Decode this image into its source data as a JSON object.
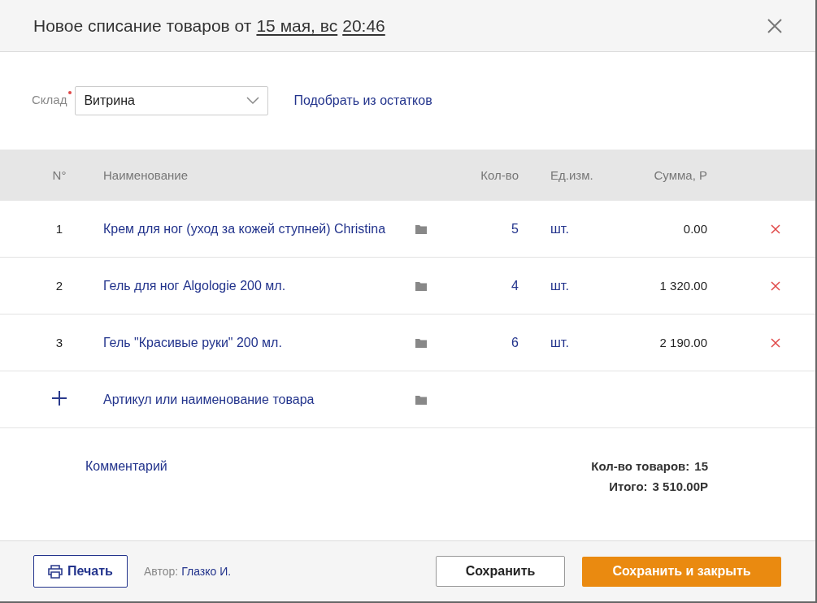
{
  "window": {
    "title": "Новое списание товаров от",
    "date": "15 мая, вс",
    "time": "20:46"
  },
  "warehouse": {
    "label": "Склад",
    "required": true,
    "value": "Витрина"
  },
  "pick_link": "Подобрать из остатков",
  "table": {
    "columns": [
      "N°",
      "Наименование",
      "Кол-во",
      "Ед.изм.",
      "Сумма, Р"
    ],
    "rows": [
      {
        "no": "1",
        "name": "Крем для ног (уход за кожей ступней) Christina",
        "qty": "5",
        "unit": "шт.",
        "sum": "0.00"
      },
      {
        "no": "2",
        "name": "Гель для ног Algologie 200 мл.",
        "qty": "4",
        "unit": "шт.",
        "sum": "1 320.00"
      },
      {
        "no": "3",
        "name": "Гель \"Красивые руки\" 200 мл.",
        "qty": "6",
        "unit": "шт.",
        "sum": "2 190.00"
      }
    ],
    "add_row": {
      "placeholder": "Артикул или наименование товара"
    }
  },
  "comment_link": "Комментарий",
  "totals": [
    {
      "label": "Кол-во товаров:",
      "value": "15"
    },
    {
      "label": "Итого:",
      "value": "3 510.00Р"
    }
  ],
  "footer": {
    "print": "Печать",
    "author_label": "Автор:",
    "author": "Глазко И.",
    "save": "Сохранить",
    "save_close": "Сохранить и закрыть"
  }
}
